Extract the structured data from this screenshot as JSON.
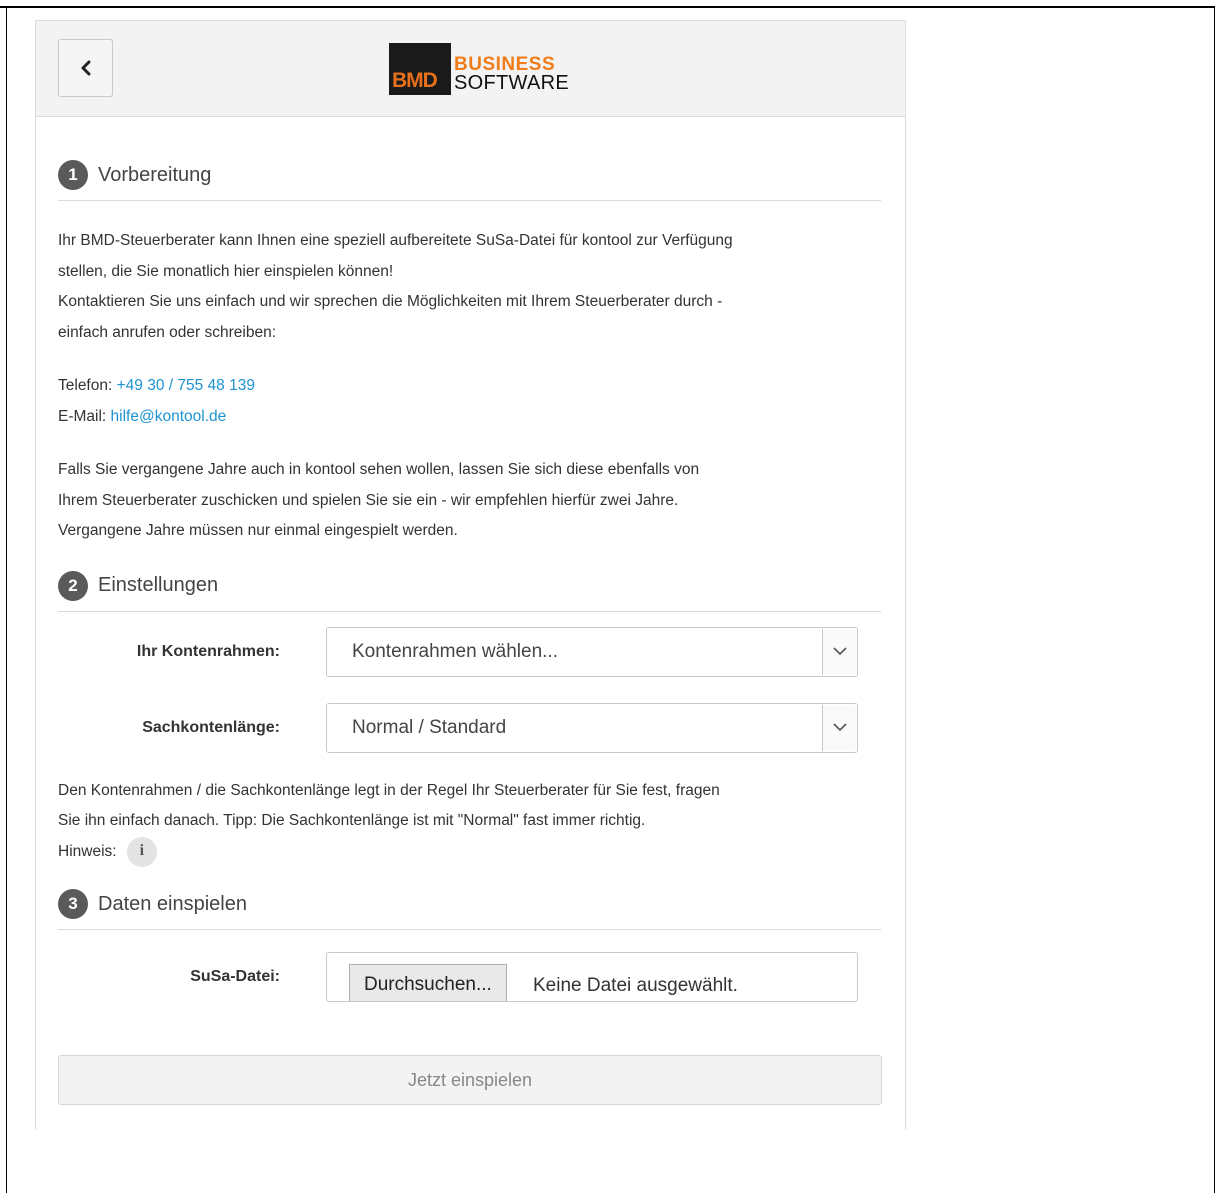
{
  "header": {
    "back_icon": "chevron-left-icon",
    "logo": {
      "mark": "BMD",
      "line1": "BUSINESS",
      "line2": "SOFTWARE",
      "accent": "#f07d1a"
    }
  },
  "sections": {
    "prep": {
      "number": "1",
      "title": "Vorbereitung",
      "para1_line1": "Ihr BMD-Steuerberater kann Ihnen eine speziell aufbereitete SuSa-Datei für kontool zur Verfügung",
      "para1_line2": "stellen, die Sie monatlich hier einspielen können!",
      "para1_line3": "Kontaktieren Sie uns einfach und wir sprechen die Möglichkeiten mit Ihrem Steuerberater durch -",
      "para1_line4": "einfach anrufen oder schreiben:",
      "phone_label": "Telefon:",
      "phone_value": "+49 30 / 755 48 139",
      "email_label": "E-Mail:",
      "email_value": "hilfe@kontool.de",
      "para2_line1": "Falls Sie vergangene Jahre auch in kontool sehen wollen, lassen Sie sich diese ebenfalls von",
      "para2_line2": "Ihrem Steuerberater zuschicken und spielen Sie sie ein - wir empfehlen hierfür zwei Jahre.",
      "para2_line3": "Vergangene Jahre müssen nur einmal eingespielt werden."
    },
    "settings": {
      "number": "2",
      "title": "Einstellungen",
      "kontenrahmen_label": "Ihr Kontenrahmen:",
      "kontenrahmen_value": "Kontenrahmen wählen...",
      "sachkonten_label": "Sachkontenlänge:",
      "sachkonten_value": "Normal / Standard",
      "hint_line1": "Den Kontenrahmen / die Sachkontenlänge legt in der Regel Ihr Steuerberater für Sie fest, fragen",
      "hint_line2": "Sie ihn einfach danach. Tipp: Die Sachkontenlänge ist mit \"Normal\" fast immer richtig.",
      "hinweis_label": "Hinweis:",
      "info_icon": "info-icon",
      "info_glyph": "i"
    },
    "import": {
      "number": "3",
      "title": "Daten einspielen",
      "file_label": "SuSa-Datei:",
      "browse_label": "Durchsuchen...",
      "file_status": "Keine Datei ausgewählt.",
      "submit_label": "Jetzt einspielen"
    }
  }
}
